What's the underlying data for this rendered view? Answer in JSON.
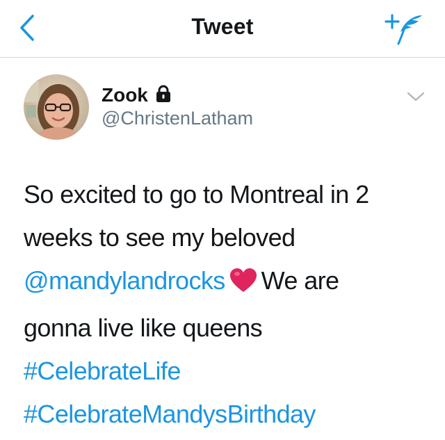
{
  "header": {
    "title": "Tweet"
  },
  "tweet": {
    "display_name": "Zook",
    "handle": "@ChristenLatham",
    "text_line1": "So excited to go to Montreal in 2",
    "text_line2": "weeks to see my beloved",
    "mention": "@mandylandrocks",
    "text_after_mention": "We are",
    "text_line4": "gonna live like queens",
    "hashtag1": "#CelebrateLife",
    "hashtag2": "#CelebrateMandysBirthday"
  },
  "colors": {
    "accent": "#1b95e0",
    "text": "#14171a",
    "secondary_text": "#657786",
    "heart": "#e0245e"
  },
  "icons": {
    "back": "chevron-left-icon",
    "compose": "compose-feather-icon",
    "lock": "lock-icon",
    "caret": "chevron-down-icon",
    "heart": "heart-emoji"
  }
}
